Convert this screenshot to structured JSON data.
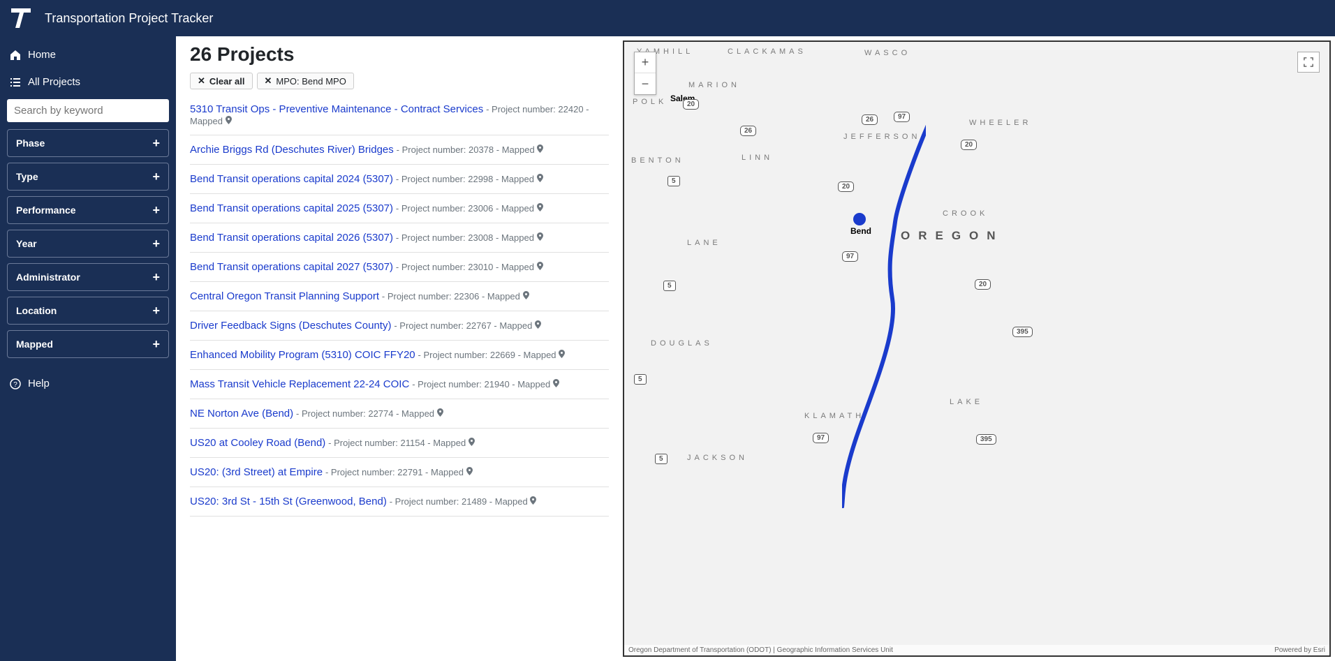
{
  "header": {
    "title": "Transportation Project Tracker"
  },
  "nav": {
    "home": "Home",
    "all_projects": "All Projects",
    "help": "Help",
    "search_placeholder": "Search by keyword"
  },
  "filters": [
    {
      "label": "Phase"
    },
    {
      "label": "Type"
    },
    {
      "label": "Performance"
    },
    {
      "label": "Year"
    },
    {
      "label": "Administrator"
    },
    {
      "label": "Location"
    },
    {
      "label": "Mapped"
    }
  ],
  "chips": {
    "clear_all": "Clear all",
    "applied": [
      {
        "label": "MPO: Bend MPO"
      }
    ]
  },
  "list": {
    "title": "26 Projects",
    "items": [
      {
        "name": "5310 Transit Ops - Preventive Maintenance - Contract Services",
        "number": "22420",
        "mapped": true
      },
      {
        "name": "Archie Briggs Rd (Deschutes River) Bridges",
        "number": "20378",
        "mapped": true
      },
      {
        "name": "Bend Transit operations capital 2024 (5307)",
        "number": "22998",
        "mapped": true
      },
      {
        "name": "Bend Transit operations capital 2025 (5307)",
        "number": "23006",
        "mapped": true
      },
      {
        "name": "Bend Transit operations capital 2026 (5307)",
        "number": "23008",
        "mapped": true
      },
      {
        "name": "Bend Transit operations capital 2027 (5307)",
        "number": "23010",
        "mapped": true
      },
      {
        "name": "Central Oregon Transit Planning Support",
        "number": "22306",
        "mapped": true
      },
      {
        "name": "Driver Feedback Signs (Deschutes County)",
        "number": "22767",
        "mapped": true
      },
      {
        "name": "Enhanced Mobility Program (5310) COIC FFY20",
        "number": "22669",
        "mapped": true
      },
      {
        "name": "Mass Transit Vehicle Replacement 22-24 COIC",
        "number": "21940",
        "mapped": true
      },
      {
        "name": "NE Norton Ave (Bend)",
        "number": "22774",
        "mapped": true
      },
      {
        "name": "US20 at Cooley Road (Bend)",
        "number": "21154",
        "mapped": true
      },
      {
        "name": "US20: (3rd Street) at Empire",
        "number": "22791",
        "mapped": true
      },
      {
        "name": "US20: 3rd St - 15th St (Greenwood, Bend)",
        "number": "21489",
        "mapped": true
      }
    ],
    "meta_prefix": "Project number:",
    "mapped_label": "Mapped"
  },
  "map": {
    "state": "OREGON",
    "major_city": "Salem",
    "highlight_city": "Bend",
    "counties": [
      "YAMHILL",
      "CLACKAMAS",
      "WASCO",
      "MARION",
      "WHEELER",
      "JEFFERSON",
      "LINN",
      "BENTON",
      "CROOK",
      "LANE",
      "DOUGLAS",
      "KLAMATH",
      "LAKE",
      "JACKSON",
      "POLK"
    ],
    "shields": [
      "97",
      "26",
      "26",
      "20",
      "20",
      "5",
      "97",
      "20",
      "5",
      "20",
      "5",
      "395",
      "97",
      "395",
      "5"
    ],
    "attribution_left": "Oregon Department of Transportation (ODOT) | Geographic Information Services Unit",
    "attribution_right": "Powered by Esri"
  }
}
